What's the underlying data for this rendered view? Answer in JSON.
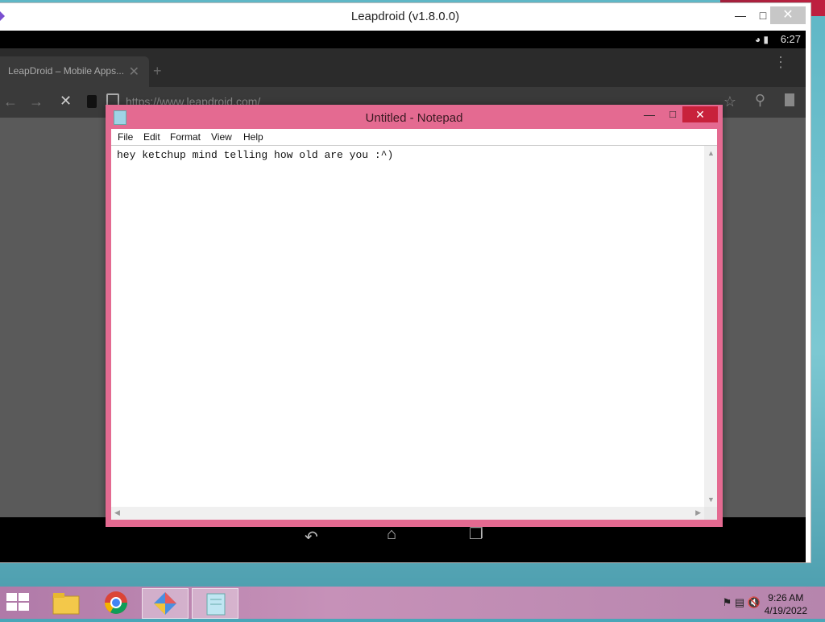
{
  "leapdroid": {
    "title": "Leapdroid (v1.8.0.0)",
    "min_icon": "minimize-icon",
    "max_icon": "maximize-icon",
    "close_icon": "close-icon"
  },
  "android": {
    "status_time": "6:27",
    "browser": {
      "tab_label": "LeapDroid – Mobile Apps...",
      "url": "https://www.leapdroid.com/"
    }
  },
  "notepad": {
    "title": "Untitled - Notepad",
    "menu": [
      "File",
      "Edit",
      "Format",
      "View",
      "Help"
    ],
    "content": "hey ketchup mind telling how old are you :^)"
  },
  "taskbar": {
    "items": [
      "file-explorer",
      "chrome",
      "leapdroid",
      "notepad"
    ],
    "active": "notepad",
    "time": "9:26 AM",
    "date": "4/19/2022"
  },
  "colors": {
    "notepad_frame": "#e46a91",
    "close_red": "#c8213b",
    "taskbar": "#c691b8"
  }
}
